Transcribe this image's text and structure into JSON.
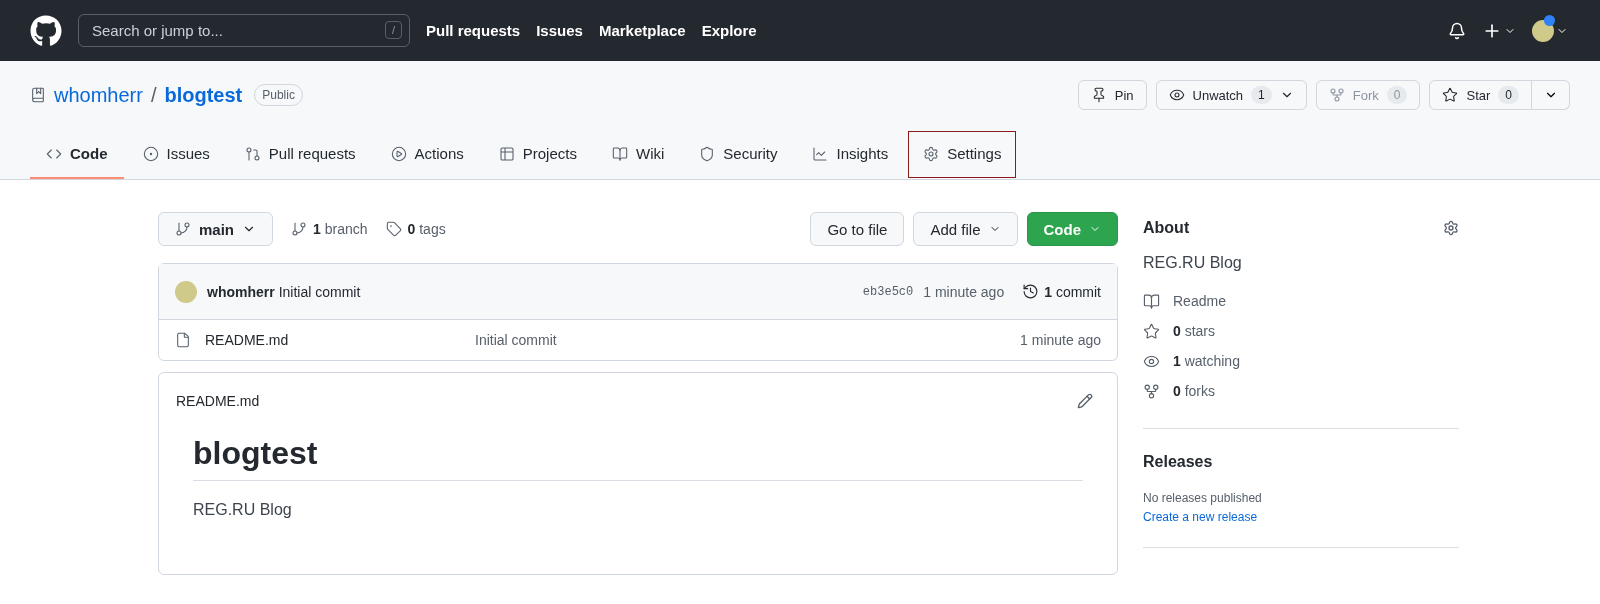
{
  "header": {
    "search": {
      "placeholder": "Search or jump to...",
      "key": "/"
    },
    "nav": [
      "Pull requests",
      "Issues",
      "Marketplace",
      "Explore"
    ],
    "avatar_badge": true
  },
  "repo": {
    "owner": "whomherr",
    "separator": "/",
    "name": "blogtest",
    "visibility": "Public",
    "actions": [
      {
        "kind": "pin",
        "label": "Pin",
        "disabled": false
      },
      {
        "kind": "watch",
        "label": "Unwatch",
        "count": "1",
        "dropdown": true,
        "disabled": false
      },
      {
        "kind": "fork",
        "label": "Fork",
        "count": "0",
        "disabled": true
      },
      {
        "kind": "star",
        "label": "Star",
        "count": "0",
        "split": true,
        "disabled": false
      }
    ]
  },
  "tabs": [
    {
      "kind": "code",
      "label": "Code",
      "selected": true,
      "highlighted": false
    },
    {
      "kind": "issues",
      "label": "Issues",
      "selected": false,
      "highlighted": false
    },
    {
      "kind": "pulls",
      "label": "Pull requests",
      "selected": false,
      "highlighted": false
    },
    {
      "kind": "actions",
      "label": "Actions",
      "selected": false,
      "highlighted": false
    },
    {
      "kind": "projects",
      "label": "Projects",
      "selected": false,
      "highlighted": false
    },
    {
      "kind": "wiki",
      "label": "Wiki",
      "selected": false,
      "highlighted": false
    },
    {
      "kind": "security",
      "label": "Security",
      "selected": false,
      "highlighted": false
    },
    {
      "kind": "insights",
      "label": "Insights",
      "selected": false,
      "highlighted": false
    },
    {
      "kind": "settings",
      "label": "Settings",
      "selected": false,
      "highlighted": true
    }
  ],
  "toolbar": {
    "branch": "main",
    "branches": "**1** branch",
    "tags": "**0** tags",
    "buttons": [
      {
        "kind": "plain",
        "label": "Go to file"
      },
      {
        "kind": "dropdown",
        "label": "Add file"
      },
      {
        "kind": "primary",
        "label": "Code"
      }
    ]
  },
  "commit": {
    "author": "whomherr",
    "message": "Initial commit",
    "hash": "eb3e5c0",
    "time": "1 minute ago",
    "count": "**1** commit"
  },
  "files": [
    {
      "name": "README.md",
      "message": "Initial commit",
      "time": "1 minute ago"
    }
  ],
  "readme": {
    "title": "README.md",
    "heading": "blogtest",
    "text": "REG.RU Blog"
  },
  "about": {
    "title": "About",
    "description": "REG.RU Blog",
    "items": [
      {
        "kind": "readme",
        "label": "Readme"
      },
      {
        "kind": "stars",
        "label": "**0** stars"
      },
      {
        "kind": "watching",
        "label": "**1** watching"
      },
      {
        "kind": "forks",
        "label": "**0** forks"
      }
    ]
  },
  "releases": {
    "title": "Releases",
    "empty": "No releases published",
    "link": "Create a new release"
  }
}
